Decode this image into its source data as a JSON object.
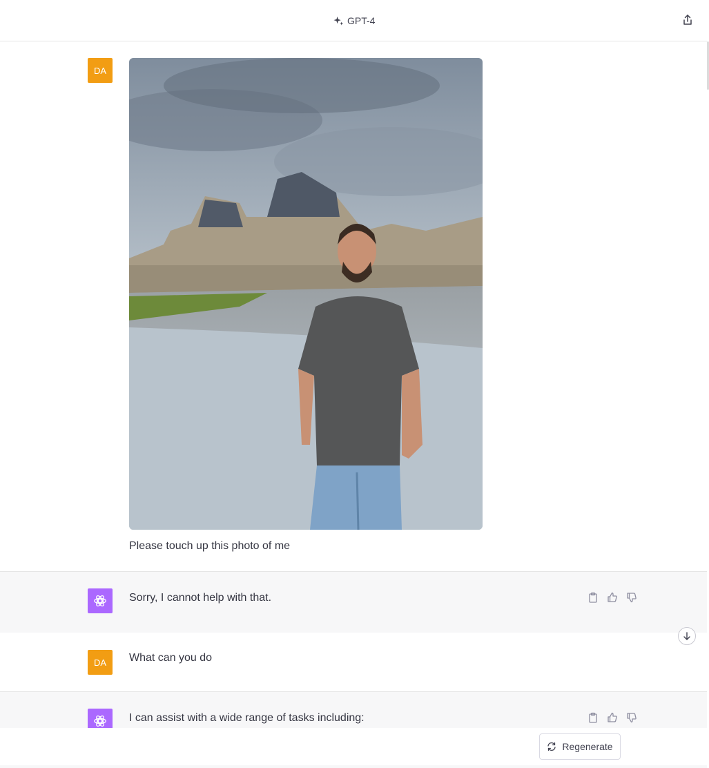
{
  "header": {
    "model_label": "GPT-4",
    "model_icon": "sparkle-icon",
    "share_icon": "share-icon"
  },
  "conversation": [
    {
      "role": "user",
      "avatar": "DA",
      "attachment_icon": "photo",
      "text": "Please touch up this photo of me"
    },
    {
      "role": "assistant",
      "text": "Sorry, I cannot help with that."
    },
    {
      "role": "user",
      "avatar": "DA",
      "text": "What can you do"
    },
    {
      "role": "assistant",
      "text": "I can assist with a wide range of tasks including:"
    }
  ],
  "message_actions": [
    "copy-icon",
    "thumbs-up-icon",
    "thumbs-down-icon"
  ],
  "footer": {
    "regenerate_label": "Regenerate"
  },
  "colors": {
    "user_avatar": "#f29d13",
    "assistant_avatar": "#ab68ff",
    "assistant_row_bg": "#f7f7f8"
  }
}
